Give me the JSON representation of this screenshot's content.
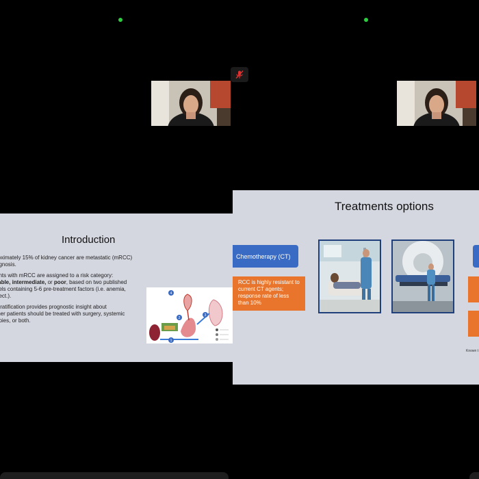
{
  "left_tile": {
    "slide": {
      "title": "Introduction",
      "bullets": [
        {
          "text": "roximately 15% of kidney cancer are metastatic (mRCC)\nagnosis."
        },
        {
          "pre": "ents with mRCC are assigned to a risk category:\n",
          "bold": "rable, intermediate,",
          "mid": " or ",
          "bold2": "poor",
          "post": ", based on two published\ndels containing 5-6 pre-treatment factors (i.e. anemia,\n, ect.)."
        },
        {
          "text": "stratification provides prognostic insight about\nther patients should be treated with surgery, systemic\napies, or both."
        }
      ],
      "diagram_markers": [
        "4",
        "2",
        "3",
        "1"
      ]
    }
  },
  "right_tile": {
    "slide": {
      "title": "Treatments options",
      "ct_label": "Chemotherapy (CT)",
      "ct_desc": "RCC is highly resistant to current CT agents; response rate of less than 10%",
      "footnote": "Known t"
    }
  },
  "colors": {
    "slide_bg": "#d4d6e0",
    "accent_blue": "#3a6bc4",
    "accent_orange": "#e8752b",
    "active_dot": "#2ecc40",
    "muted_red": "#e03030"
  }
}
